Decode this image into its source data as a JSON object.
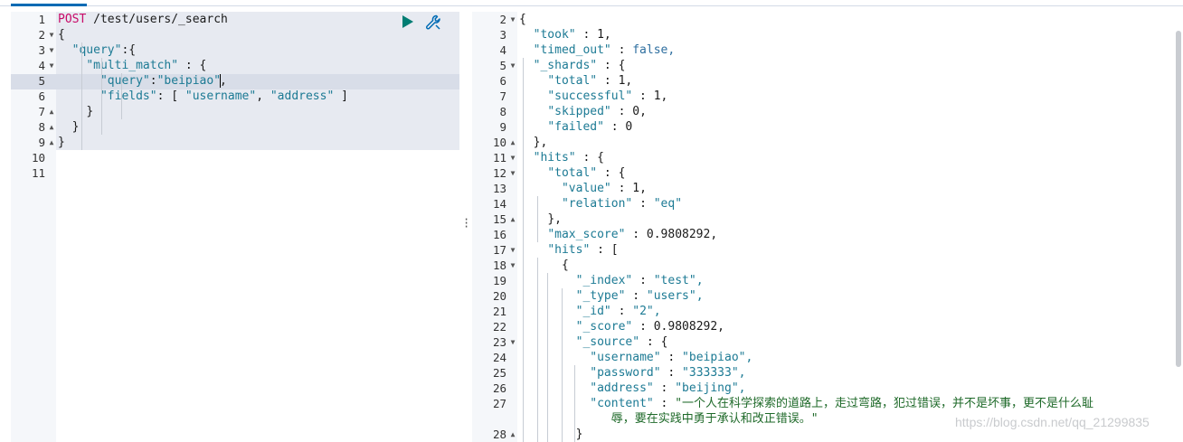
{
  "request": {
    "method": "POST",
    "path": " /test/users/_search",
    "lines": [
      {
        "n": "1",
        "fold": ""
      },
      {
        "n": "2",
        "fold": "▼"
      },
      {
        "n": "3",
        "fold": "▼"
      },
      {
        "n": "4",
        "fold": "▼"
      },
      {
        "n": "5",
        "fold": ""
      },
      {
        "n": "6",
        "fold": ""
      },
      {
        "n": "7",
        "fold": "▲"
      },
      {
        "n": "8",
        "fold": "▲"
      },
      {
        "n": "9",
        "fold": "▲"
      },
      {
        "n": "10",
        "fold": ""
      },
      {
        "n": "11",
        "fold": ""
      }
    ],
    "body": {
      "open_brace": "{",
      "query_key": "\"query\"",
      "query_open": ":{",
      "multi_match_key": "\"multi_match\"",
      "multi_match_open": " : {",
      "inner_query_key": "\"query\"",
      "inner_query_sep": ":",
      "inner_query_val": "\"beipiao\"",
      "inner_query_end": ",",
      "fields_key": "\"fields\"",
      "fields_open": ": [ ",
      "field_1": "\"username\"",
      "field_sep": ", ",
      "field_2": "\"address\"",
      "fields_close": " ]",
      "close_inner": "}",
      "close_query": "}",
      "close_root": "}"
    }
  },
  "response": {
    "lines": [
      {
        "n": "2",
        "fold": "▼",
        "text": "{",
        "type": "plain",
        "indent": 0
      },
      {
        "n": "3",
        "fold": "",
        "key": "\"took\"",
        "val": "1,",
        "vtype": "num",
        "indent": 1
      },
      {
        "n": "4",
        "fold": "",
        "key": "\"timed_out\"",
        "val": "false,",
        "vtype": "bool",
        "indent": 1
      },
      {
        "n": "5",
        "fold": "▼",
        "key": "\"_shards\"",
        "val": "{",
        "vtype": "punct",
        "indent": 1
      },
      {
        "n": "6",
        "fold": "",
        "key": "\"total\"",
        "val": "1,",
        "vtype": "num",
        "indent": 2
      },
      {
        "n": "7",
        "fold": "",
        "key": "\"successful\"",
        "val": "1,",
        "vtype": "num",
        "indent": 2
      },
      {
        "n": "8",
        "fold": "",
        "key": "\"skipped\"",
        "val": "0,",
        "vtype": "num",
        "indent": 2
      },
      {
        "n": "9",
        "fold": "",
        "key": "\"failed\"",
        "val": "0",
        "vtype": "num",
        "indent": 2
      },
      {
        "n": "10",
        "fold": "▲",
        "text": "},",
        "type": "plain",
        "indent": 1
      },
      {
        "n": "11",
        "fold": "▼",
        "key": "\"hits\"",
        "val": "{",
        "vtype": "punct",
        "indent": 1
      },
      {
        "n": "12",
        "fold": "▼",
        "key": "\"total\"",
        "val": "{",
        "vtype": "punct",
        "indent": 2
      },
      {
        "n": "13",
        "fold": "",
        "key": "\"value\"",
        "val": "1,",
        "vtype": "num",
        "indent": 3
      },
      {
        "n": "14",
        "fold": "",
        "key": "\"relation\"",
        "val": "\"eq\"",
        "vtype": "str",
        "indent": 3
      },
      {
        "n": "15",
        "fold": "▲",
        "text": "},",
        "type": "plain",
        "indent": 2
      },
      {
        "n": "16",
        "fold": "",
        "key": "\"max_score\"",
        "val": "0.9808292,",
        "vtype": "num",
        "indent": 2
      },
      {
        "n": "17",
        "fold": "▼",
        "key": "\"hits\"",
        "val": "[",
        "vtype": "punct",
        "indent": 2
      },
      {
        "n": "18",
        "fold": "▼",
        "text": "{",
        "type": "plain",
        "indent": 3
      },
      {
        "n": "19",
        "fold": "",
        "key": "\"_index\"",
        "val": "\"test\",",
        "vtype": "str",
        "indent": 4
      },
      {
        "n": "20",
        "fold": "",
        "key": "\"_type\"",
        "val": "\"users\",",
        "vtype": "str",
        "indent": 4
      },
      {
        "n": "21",
        "fold": "",
        "key": "\"_id\"",
        "val": "\"2\",",
        "vtype": "str",
        "indent": 4
      },
      {
        "n": "22",
        "fold": "",
        "key": "\"_score\"",
        "val": "0.9808292,",
        "vtype": "num",
        "indent": 4
      },
      {
        "n": "23",
        "fold": "▼",
        "key": "\"_source\"",
        "val": "{",
        "vtype": "punct",
        "indent": 4
      },
      {
        "n": "24",
        "fold": "",
        "key": "\"username\"",
        "val": "\"beipiao\",",
        "vtype": "str",
        "indent": 5
      },
      {
        "n": "25",
        "fold": "",
        "key": "\"password\"",
        "val": "\"333333\",",
        "vtype": "str",
        "indent": 5
      },
      {
        "n": "26",
        "fold": "",
        "key": "\"address\"",
        "val": "\"beijing\",",
        "vtype": "str",
        "indent": 5
      },
      {
        "n": "27",
        "fold": "",
        "key": "\"content\"",
        "val": "\"一个人在科学探索的道路上，走过弯路，犯过错误，并不是坏事，更不是什么耻",
        "vtype": "cn",
        "indent": 5
      },
      {
        "n": "",
        "fold": "",
        "text": "辱，要在实践中勇于承认和改正错误。\"",
        "type": "cn-cont",
        "indent": 6
      },
      {
        "n": "28",
        "fold": "▲",
        "text": "}",
        "type": "plain",
        "indent": 4
      }
    ]
  },
  "watermark": "https://blog.csdn.net/qq_21299835",
  "colors": {
    "method": "#c80a68",
    "string": "#1c7a94",
    "run": "#017d73",
    "accent": "#006bb4"
  }
}
